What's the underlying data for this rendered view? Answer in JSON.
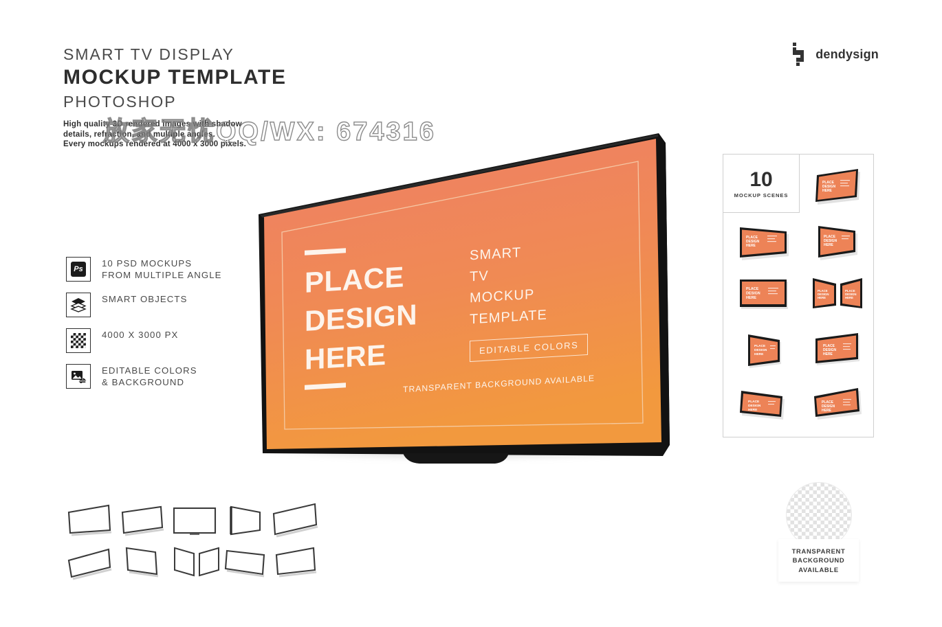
{
  "header": {
    "line1": "SMART TV DISPLAY",
    "line2": "MOCKUP TEMPLATE",
    "line3": "PHOTOSHOP",
    "desc_line1": "High quality 3D rendered images with shadow",
    "desc_line2": "details, refraction, and multiple angles.",
    "desc_line3": "Every mockups rendered at 4000 x 3000 pixels."
  },
  "watermark": {
    "text": "放家无忧QQ/WX: 674316"
  },
  "logo": {
    "name": "dendysign"
  },
  "features": [
    {
      "icon": "photoshop-icon",
      "line1": "10 PSD MOCKUPS",
      "line2": "FROM MULTIPLE ANGLE"
    },
    {
      "icon": "layers-icon",
      "line1": "SMART OBJECTS",
      "line2": ""
    },
    {
      "icon": "checkerboard-icon",
      "line1": "4000 X 3000 PX",
      "line2": ""
    },
    {
      "icon": "image-swap-icon",
      "line1": "EDITABLE COLORS",
      "line2": "& BACKGROUND"
    }
  ],
  "screen": {
    "headline_l1": "PLACE",
    "headline_l2": "DESIGN",
    "headline_l3": "HERE",
    "side_l1": "SMART",
    "side_l2": "TV",
    "side_l3": "MOCKUP",
    "side_l4": "TEMPLATE",
    "button": "EDITABLE COLORS",
    "footnote": "TRANSPARENT BACKGROUND AVAILABLE",
    "color_top": "#EE8268",
    "color_bottom": "#F1983F",
    "bezel_color": "#121212",
    "text_color": "#FDF4EC"
  },
  "scenes": {
    "count": "10",
    "label": "MOCKUP SCENES",
    "thumb_text_l1": "PLACE",
    "thumb_text_l2": "DESIGN",
    "thumb_text_l3": "HERE"
  },
  "transparent_badge": {
    "line1": "TRANSPARENT",
    "line2": "BACKGROUND",
    "line3": "AVAILABLE"
  },
  "wireframes": {
    "count": 10
  }
}
